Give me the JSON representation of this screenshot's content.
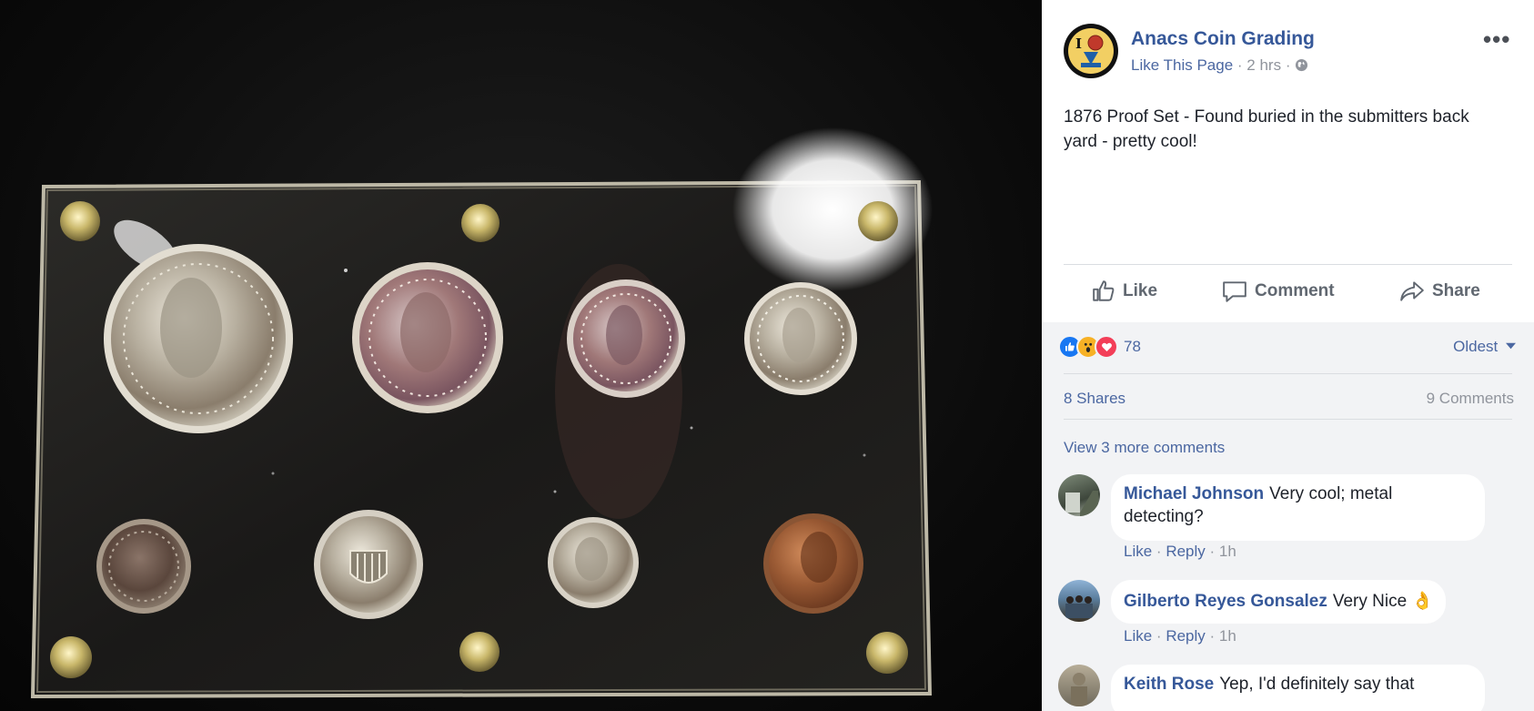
{
  "post": {
    "page_name": "Anacs Coin Grading",
    "like_page": "Like This Page",
    "time": "2 hrs",
    "text": "1876 Proof Set - Found buried in the submitters back yard - pretty cool!",
    "photo_alt": "1876 proof coin set in an acrylic holder"
  },
  "actions": {
    "like": "Like",
    "comment": "Comment",
    "share": "Share"
  },
  "stats": {
    "reaction_count": "78",
    "sort_label": "Oldest",
    "shares": "8 Shares",
    "comments": "9 Comments",
    "view_more": "View 3 more comments"
  },
  "comments": [
    {
      "author": "Michael Johnson",
      "text": "Very cool; metal detecting?",
      "like": "Like",
      "reply": "Reply",
      "time": "1h"
    },
    {
      "author": "Gilberto Reyes Gonsalez",
      "text": "Very Nice 👌",
      "like": "Like",
      "reply": "Reply",
      "time": "1h"
    },
    {
      "author": "Keith Rose",
      "text": "Yep, I'd definitely say that"
    }
  ],
  "colors": {
    "link_blue": "#365899",
    "meta_gray": "#90949c",
    "like_blue": "#1877f2",
    "love_red": "#f33e58",
    "wow_yellow": "#f7b125",
    "coin_silver": "#c9c3b4",
    "coin_copper": "#9a5a34"
  }
}
